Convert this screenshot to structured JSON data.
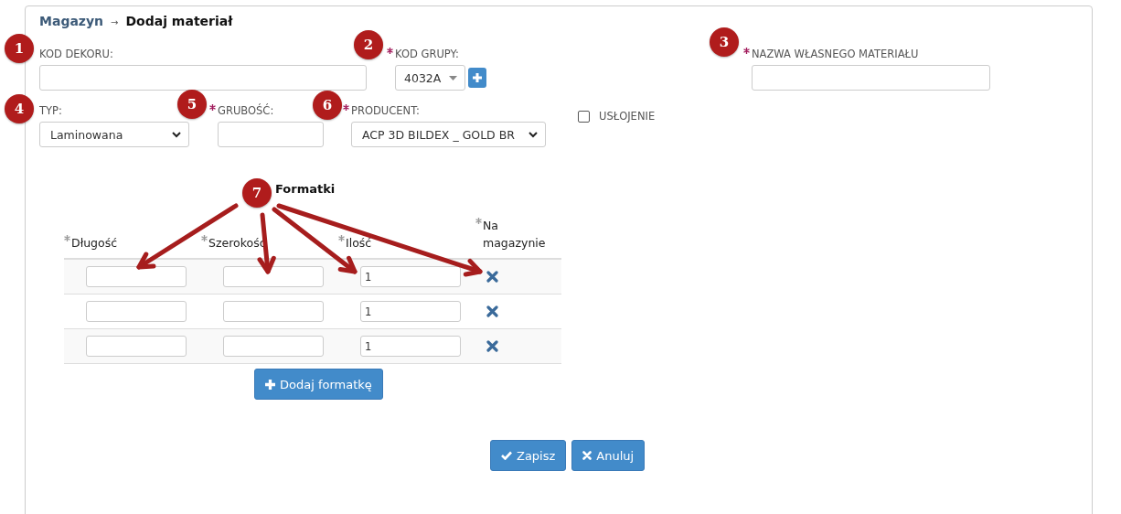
{
  "breadcrumb": {
    "parent": "Magazyn",
    "separator": "→",
    "current": "Dodaj materiał"
  },
  "field_rows": [
    [
      {
        "kind": "text",
        "label": "KOD DEKORU:",
        "required": false
      },
      {
        "kind": "select",
        "label": "KOD GRUPY:",
        "required": true,
        "value": "4032A",
        "add_button": true
      },
      {
        "kind": "text",
        "label": "NAZWA WŁASNEGO MATERIAŁU",
        "required": true
      }
    ],
    [
      {
        "kind": "select",
        "label": "TYP:",
        "required": false,
        "value": "Laminowana"
      },
      {
        "kind": "text",
        "label": "GRUBOŚĆ:",
        "required": true
      },
      {
        "kind": "select",
        "label": "PRODUCENT:",
        "required": true,
        "value": "ACP 3D BILDEX _ GOLD BR"
      },
      {
        "kind": "checkbox",
        "label": "USŁOJENIE",
        "checked": false
      }
    ]
  ],
  "formatki": {
    "title": "Formatki",
    "columns": [
      {
        "label": "Długość",
        "required": true
      },
      {
        "label": "Szerokość",
        "required": true
      },
      {
        "label": "Ilość",
        "required": true
      },
      {
        "label": "Na magazynie",
        "required": true
      }
    ],
    "rows": [
      {
        "ilosc": "1",
        "in_stock": false
      },
      {
        "ilosc": "1",
        "in_stock": false
      },
      {
        "ilosc": "1",
        "in_stock": false
      }
    ],
    "add_button": "Dodaj formatkę"
  },
  "buttons": [
    {
      "kind": "save",
      "label": "Zapisz"
    },
    {
      "kind": "cancel",
      "label": "Anuluj"
    }
  ],
  "annotations": [
    {
      "label": "1"
    },
    {
      "label": "2"
    },
    {
      "label": "3"
    },
    {
      "label": "4"
    },
    {
      "label": "5"
    },
    {
      "label": "6"
    },
    {
      "label": "7"
    }
  ]
}
